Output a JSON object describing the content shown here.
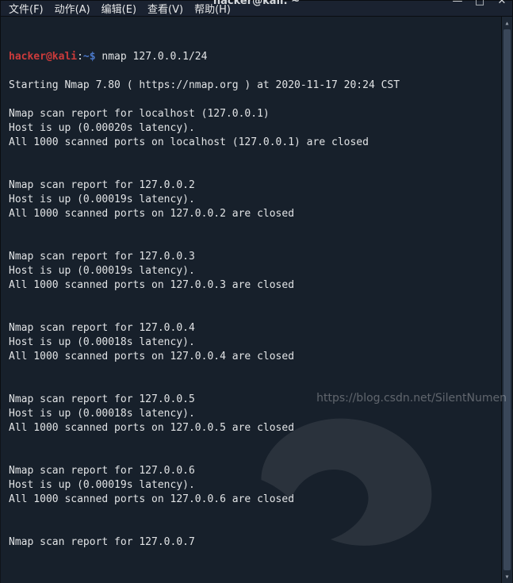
{
  "titlebar": {
    "title": "hacker@kali: ~"
  },
  "window_controls": {
    "minimize_glyph": "—",
    "maximize_glyph": "□",
    "close_glyph": "✕"
  },
  "menubar": {
    "items": [
      {
        "label": "文件(F)"
      },
      {
        "label": "动作(A)"
      },
      {
        "label": "编辑(E)"
      },
      {
        "label": "查看(V)"
      },
      {
        "label": "帮助(H)"
      }
    ]
  },
  "prompt": {
    "user": "hacker@kali",
    "sep": ":",
    "path": "~",
    "sigil": "$"
  },
  "command": "nmap 127.0.0.1/24",
  "intro": "Starting Nmap 7.80 ( https://nmap.org ) at 2020-11-17 20:24 CST",
  "hosts": [
    {
      "report": "Nmap scan report for localhost (127.0.0.1)",
      "up": "Host is up (0.00020s latency).",
      "ports": "All 1000 scanned ports on localhost (127.0.0.1) are closed"
    },
    {
      "report": "Nmap scan report for 127.0.0.2",
      "up": "Host is up (0.00019s latency).",
      "ports": "All 1000 scanned ports on 127.0.0.2 are closed"
    },
    {
      "report": "Nmap scan report for 127.0.0.3",
      "up": "Host is up (0.00019s latency).",
      "ports": "All 1000 scanned ports on 127.0.0.3 are closed"
    },
    {
      "report": "Nmap scan report for 127.0.0.4",
      "up": "Host is up (0.00018s latency).",
      "ports": "All 1000 scanned ports on 127.0.0.4 are closed"
    },
    {
      "report": "Nmap scan report for 127.0.0.5",
      "up": "Host is up (0.00018s latency).",
      "ports": "All 1000 scanned ports on 127.0.0.5 are closed"
    },
    {
      "report": "Nmap scan report for 127.0.0.6",
      "up": "Host is up (0.00019s latency).",
      "ports": "All 1000 scanned ports on 127.0.0.6 are closed"
    }
  ],
  "tail": "Nmap scan report for 127.0.0.7",
  "watermark": "https://blog.csdn.net/SilentNumen"
}
